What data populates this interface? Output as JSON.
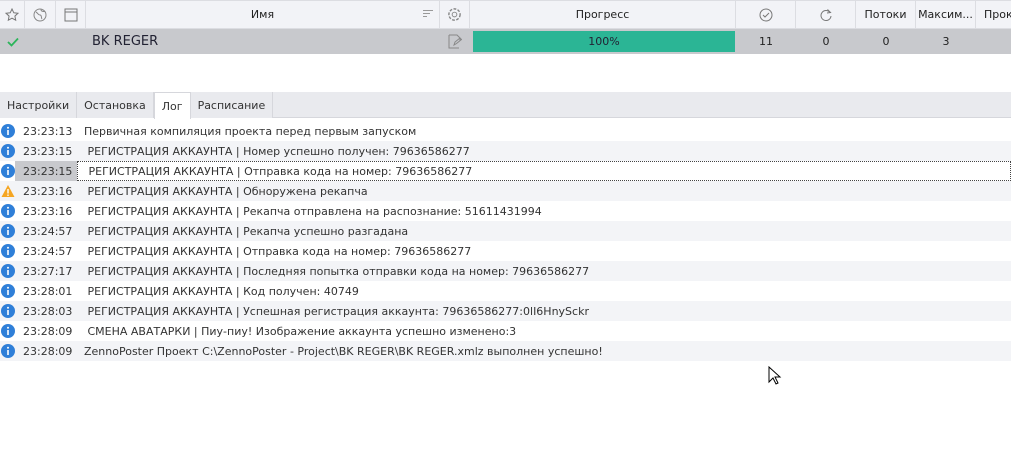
{
  "grid": {
    "headers": {
      "name": "Имя",
      "progress": "Прогресс",
      "threads": "Потоки",
      "max": "Максим...",
      "extra": "Прок"
    },
    "row": {
      "name": "BK REGER",
      "progress_label": "100%",
      "progress_value": 100,
      "success": "11",
      "retries": "0",
      "threads": "0",
      "max": "3"
    }
  },
  "tabs": [
    {
      "label": "Настройки"
    },
    {
      "label": "Остановка"
    },
    {
      "label": "Лог"
    },
    {
      "label": "Расписание"
    }
  ],
  "active_tab": "Лог",
  "log": [
    {
      "type": "info",
      "time": "23:23:13",
      "msg": "Первичная компиляция проекта перед первым запуском"
    },
    {
      "type": "info",
      "time": "23:23:15",
      "msg": " РЕГИСТРАЦИЯ АККАУНТА | Номер успешно получен: 79636586277"
    },
    {
      "type": "info",
      "time": "23:23:15",
      "msg": " РЕГИСТРАЦИЯ АККАУНТА | Отправка кода на номер: 79636586277"
    },
    {
      "type": "warning",
      "time": "23:23:16",
      "msg": " РЕГИСТРАЦИЯ АККАУНТА | Обноружена рекапча"
    },
    {
      "type": "info",
      "time": "23:23:16",
      "msg": " РЕГИСТРАЦИЯ АККАУНТА | Рекапча отправлена на распознание: 51611431994"
    },
    {
      "type": "info",
      "time": "23:24:57",
      "msg": " РЕГИСТРАЦИЯ АККАУНТА | Рекапча успешно разгадана"
    },
    {
      "type": "info",
      "time": "23:24:57",
      "msg": " РЕГИСТРАЦИЯ АККАУНТА | Отправка кода на номер: 79636586277"
    },
    {
      "type": "info",
      "time": "23:27:17",
      "msg": " РЕГИСТРАЦИЯ АККАУНТА | Последняя попытка отправки кода на номер: 79636586277"
    },
    {
      "type": "info",
      "time": "23:28:01",
      "msg": " РЕГИСТРАЦИЯ АККАУНТА | Код получен: 40749"
    },
    {
      "type": "info",
      "time": "23:28:03",
      "msg": " РЕГИСТРАЦИЯ АККАУНТА | Успешная регистрация аккаунта: 79636586277:0lI6HnySckr"
    },
    {
      "type": "info",
      "time": "23:28:09",
      "msg": " СМЕНА АВАТАРКИ | Пиу-пиу! Изображение аккаунта успешно изменено:3"
    },
    {
      "type": "info",
      "time": "23:28:09",
      "msg": "ZennoPoster Проект C:\\ZennoPoster - Project\\BK REGER\\BK REGER.xmlz выполнен успешно!"
    }
  ],
  "selected_log_index": 2,
  "colors": {
    "progress": "#2bb595",
    "info": "#2f7fd8",
    "warning": "#f5a623",
    "check": "#2bb55a"
  }
}
